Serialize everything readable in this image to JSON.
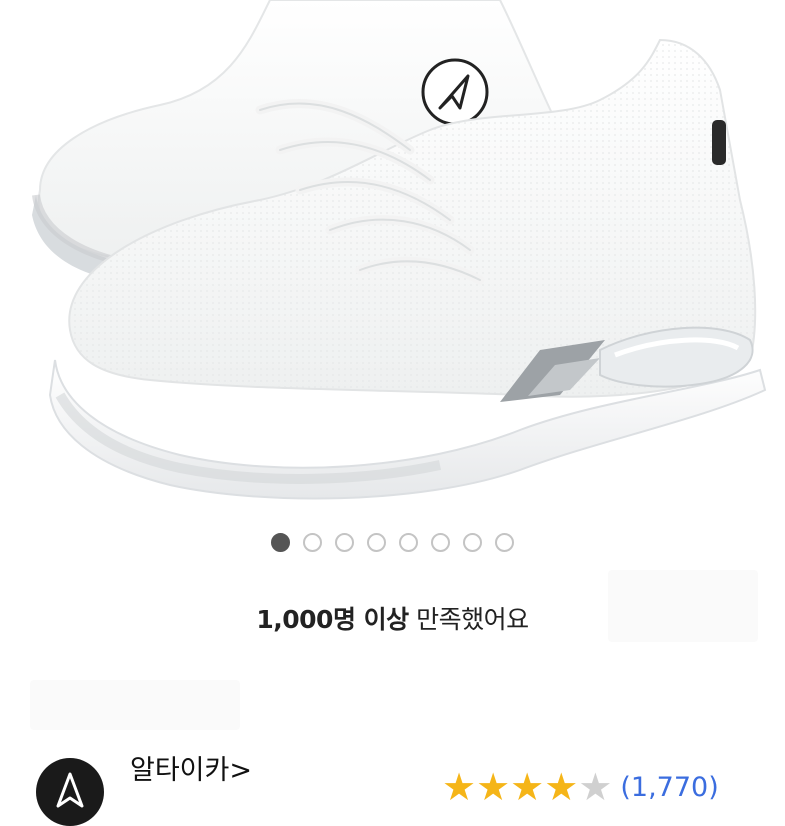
{
  "gallery": {
    "image_alt": "white knit sneaker",
    "total_slides": 8,
    "active_slide": 1
  },
  "satisfaction": {
    "strong": "1,000명 이상",
    "rest": "만족했어요"
  },
  "seller": {
    "name": "알타이카",
    "chevron": ">",
    "logo_icon": "altaica-logo-icon"
  },
  "rating": {
    "score": 4,
    "max": 5,
    "review_count": "(1,770)"
  },
  "colors": {
    "active_dot": "#555555",
    "inactive_dot": "#c4c4c4",
    "star": "#f5b518",
    "link": "#3b6ddf"
  }
}
